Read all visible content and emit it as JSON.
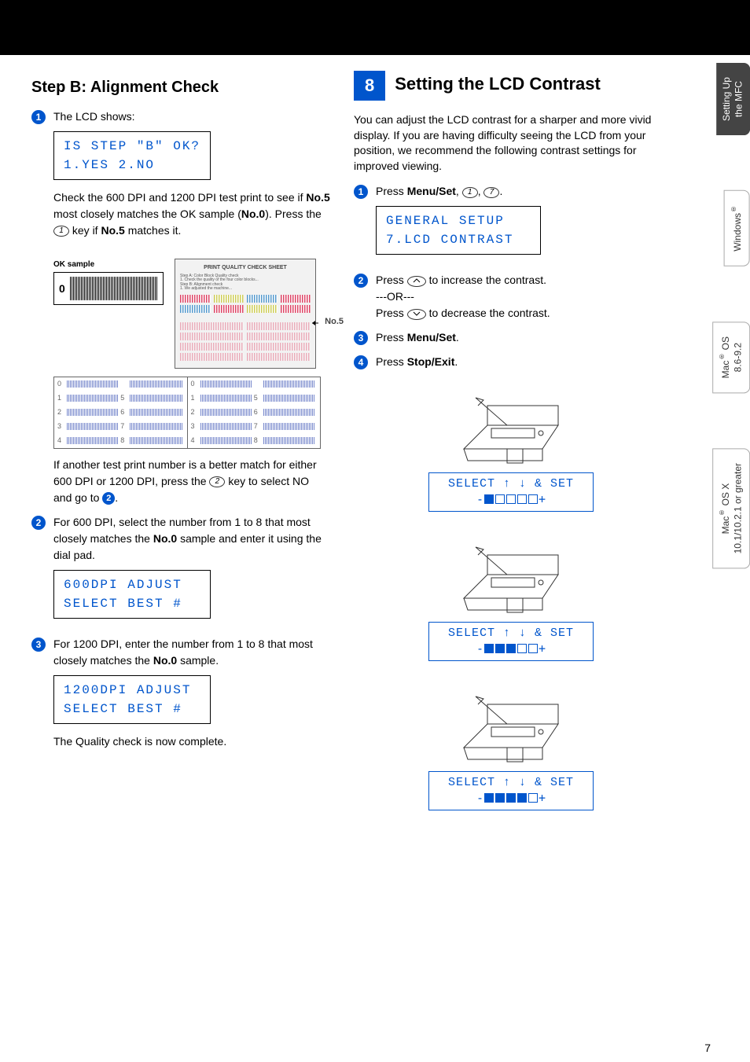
{
  "pageNumber": "7",
  "left": {
    "heading": "Step B:  Alignment Check",
    "step1_intro": "The LCD shows:",
    "lcd1_line1": "IS STEP \"B\" OK?",
    "lcd1_line2": "1.YES 2.NO",
    "para1_a": "Check the 600 DPI and 1200 DPI test print to see if ",
    "para1_bold1": "No.5",
    "para1_b": " most closely matches the OK sample (",
    "para1_bold2": "No.0",
    "para1_c": "). Press the ",
    "para1_key": "1",
    "para1_d": " key if ",
    "para1_bold3": "No.5",
    "para1_e": " matches it.",
    "ok_sample_label": "OK sample",
    "ok_sample_zero": "0",
    "quality_sheet_title": "PRINT QUALITY CHECK SHEET",
    "no5_label": "No.5",
    "para2_a": "If another test print number is a better match for either 600 DPI or 1200 DPI, press the ",
    "para2_key": "2",
    "para2_b": " key to select NO and go to ",
    "step2_text_a": "For 600 DPI, select the number from 1 to 8 that most closely matches the ",
    "step2_bold": "No.0",
    "step2_text_b": " sample and enter it using the dial pad.",
    "lcd2_line1": "600DPI ADJUST",
    "lcd2_line2": "SELECT BEST #",
    "step3_text_a": "For 1200 DPI, enter the number from 1 to 8 that most closely matches the ",
    "step3_bold": "No.0",
    "step3_text_b": " sample.",
    "lcd3_line1": "1200DPI ADJUST",
    "lcd3_line2": "SELECT BEST #",
    "finish": "The Quality check is now complete."
  },
  "right": {
    "section_number": "8",
    "section_title": "Setting the LCD Contrast",
    "intro": "You can adjust the LCD contrast for a sharper and more vivid display. If you are having difficulty seeing the LCD from your position, we recommend the following contrast settings for improved viewing.",
    "step1_a": "Press ",
    "step1_bold": "Menu/Set",
    "step1_b": ", ",
    "step1_key1": "1",
    "step1_c": ", ",
    "step1_key2": "7",
    "step1_d": ".",
    "lcd1_line1": "GENERAL SETUP",
    "lcd1_line2": "7.LCD CONTRAST",
    "step2_a": "Press ",
    "step2_b": " to increase the contrast.",
    "step2_or": "---OR---",
    "step2_c": "Press ",
    "step2_d": " to decrease the contrast.",
    "step3_a": "Press ",
    "step3_bold": "Menu/Set",
    "step3_b": ".",
    "step4_a": "Press ",
    "step4_bold": "Stop/Exit",
    "step4_b": ".",
    "select_label_line1": "SELECT ↑ ↓ & SET"
  },
  "sideTabs": {
    "tab1_line1": "Setting Up",
    "tab1_line2": "the MFC",
    "tab2": "Windows",
    "tab3_line1": "Mac",
    "tab3_line2": " OS",
    "tab3_line3": "8.6-9.2",
    "tab4_line1": "Mac",
    "tab4_line2": " OS X",
    "tab4_line3": "10.1/10.2.1 or greater"
  }
}
